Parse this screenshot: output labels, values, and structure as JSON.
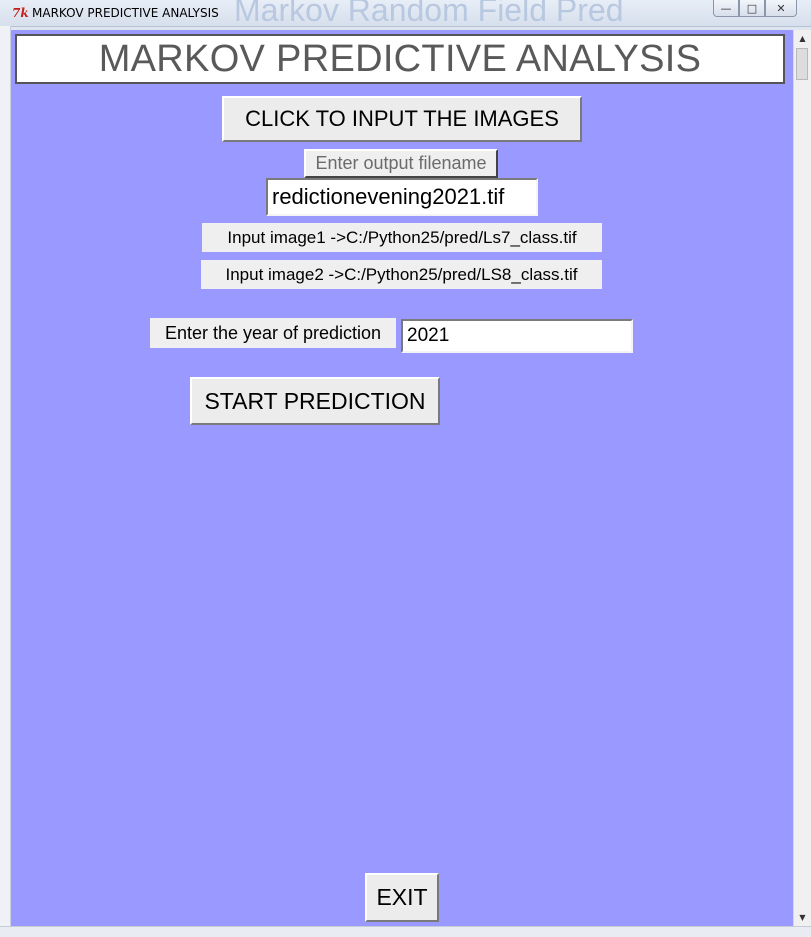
{
  "window": {
    "title": "MARKOV PREDICTIVE ANALYSIS",
    "background_title": "Markov Random Field Pred",
    "tk_icon": "7k",
    "controls": {
      "minimize": "—",
      "maximize": "□",
      "close": "✕"
    }
  },
  "main": {
    "heading": "MARKOV PREDICTIVE ANALYSIS",
    "input_images_button": "CLICK TO INPUT THE IMAGES",
    "output_filename_label": "Enter output filename",
    "output_filename_value": "redictionevening2021.tif",
    "input_image1_label": "Input image1 ->C:/Python25/pred/Ls7_class.tif",
    "input_image2_label": "Input image2 ->C:/Python25/pred/LS8_class.tif",
    "year_label": "Enter the year of prediction",
    "year_value": "2021",
    "start_button": "START PREDICTION",
    "exit_button": "EXIT"
  },
  "scrollbar": {
    "up": "▲",
    "down": "▼"
  },
  "colors": {
    "client_background": "#9999ff",
    "heading_text": "#595959",
    "button_face": "#ececec"
  }
}
